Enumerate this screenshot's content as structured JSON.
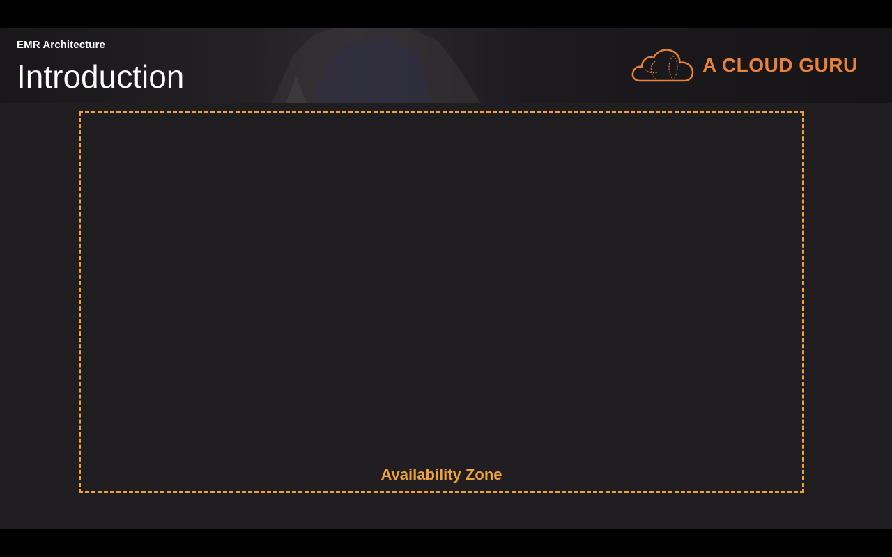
{
  "header": {
    "section": "EMR Architecture",
    "title": "Introduction"
  },
  "brand": {
    "name": "A CLOUD GURU",
    "icon": "cloud-logo-icon",
    "color": "#e8823a"
  },
  "diagram": {
    "zone_label": "Availability Zone",
    "border_color": "#f0a23a"
  },
  "colors": {
    "background": "#201e21",
    "letterbox": "#000000",
    "title_text": "#ffffff"
  }
}
